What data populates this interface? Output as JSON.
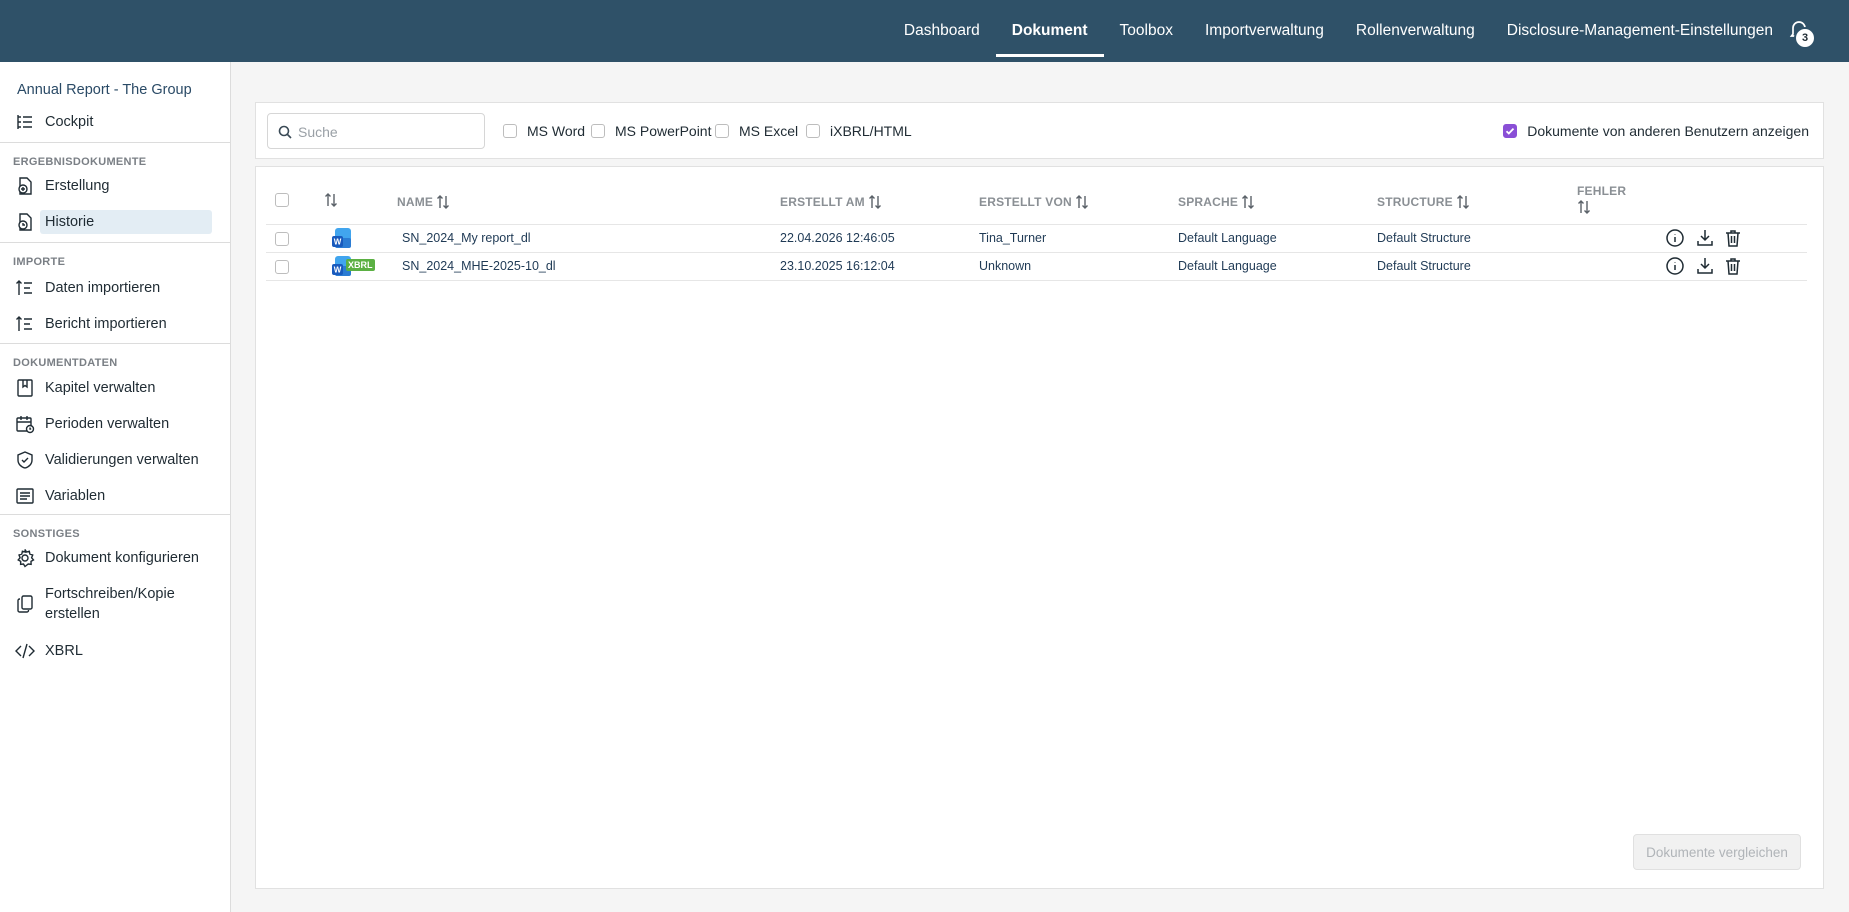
{
  "nav": {
    "items": [
      "Dashboard",
      "Dokument",
      "Toolbox",
      "Importverwaltung",
      "Rollenverwaltung",
      "Disclosure-Management-Einstellungen"
    ],
    "active": "Dokument",
    "notification_count": "3"
  },
  "sidebar": {
    "title": "Annual Report - The Group",
    "cockpit": "Cockpit",
    "sections": {
      "ergebnis": "ERGEBNISDOKUMENTE",
      "importe": "IMPORTE",
      "dokumentdaten": "DOKUMENTDATEN",
      "sonstiges": "SONSTIGES"
    },
    "items": {
      "erstellung": "Erstellung",
      "historie": "Historie",
      "daten_importieren": "Daten importieren",
      "bericht_importieren": "Bericht importieren",
      "kapitel": "Kapitel verwalten",
      "perioden": "Perioden verwalten",
      "validierungen": "Validierungen verwalten",
      "variablen": "Variablen",
      "konfigurieren": "Dokument konfigurieren",
      "fortschreiben_1": "Fortschreiben/Kopie",
      "fortschreiben_2": "erstellen",
      "xbrl": "XBRL"
    },
    "selected": "Historie"
  },
  "filters": {
    "search_placeholder": "Suche",
    "options": [
      "MS Word",
      "MS PowerPoint",
      "MS Excel",
      "iXBRL/HTML"
    ],
    "show_others_label": "Dokumente von anderen Benutzern anzeigen",
    "show_others_checked": true
  },
  "table": {
    "headers": {
      "name": "NAME",
      "created_at": "ERSTELLT AM",
      "created_by": "ERSTELLT VON",
      "language": "SPRACHE",
      "structure": "STRUCTURE",
      "errors": "FEHLER"
    },
    "rows": [
      {
        "name": "SN_2024_My report_dl",
        "created_at": "22.04.2026 12:46:05",
        "created_by": "Tina_Turner",
        "language": "Default Language",
        "structure": "Default Structure",
        "type": "word"
      },
      {
        "name": "SN_2024_MHE-2025-10_dl",
        "created_at": "23.10.2025 16:12:04",
        "created_by": "Unknown",
        "language": "Default Language",
        "structure": "Default Structure",
        "type": "word+xbrl",
        "xbrl_tag": "XBRL"
      }
    ]
  },
  "compare_button": "Dokumente vergleichen",
  "colors": {
    "topbar": "#2f5168",
    "accent_checkbox": "#8a4fd6",
    "selected_bg": "#e3edf4"
  }
}
